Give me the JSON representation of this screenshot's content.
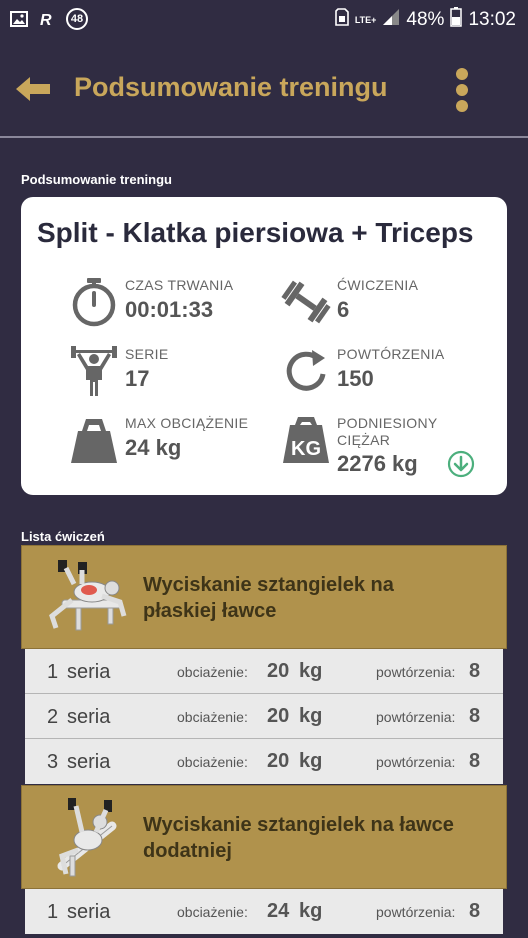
{
  "status": {
    "battery": "48%",
    "time": "13:02",
    "network": "LTE+",
    "notification_badge": "48"
  },
  "appbar": {
    "title": "Podsumowanie treningu",
    "accent": "#c9a75b"
  },
  "summary": {
    "section_label": "Podsumowanie treningu",
    "workout_name": "Split - Klatka piersiowa + Triceps",
    "stats": {
      "duration": {
        "label": "CZAS TRWANIA",
        "value": "00:01:33",
        "icon": "stopwatch-icon"
      },
      "exercises": {
        "label": "ĆWICZENIA",
        "value": "6",
        "icon": "dumbbell-icon"
      },
      "sets": {
        "label": "SERIE",
        "value": "17",
        "icon": "weightlifter-icon"
      },
      "reps": {
        "label": "POWTÓRZENIA",
        "value": "150",
        "icon": "repeat-icon"
      },
      "max_load": {
        "label": "MAX OBCIĄŻENIE",
        "value": "24 kg",
        "icon": "kettlebell-icon"
      },
      "lifted": {
        "label_line1": "PODNIESIONY",
        "label_line2": "CIĘŻAR",
        "value": "2276 kg",
        "icon": "kg-weight-icon"
      }
    }
  },
  "exercise_list": {
    "section_label": "Lista ćwiczeń",
    "set_word": "seria",
    "load_label": "obciażenie:",
    "reps_label": "powtórzenia:",
    "unit": "kg",
    "exercises": [
      {
        "name_line1": "Wyciskanie sztangielek na",
        "name_line2": "płaskiej ławce",
        "sets": [
          {
            "no": "1",
            "load": "20",
            "reps": "8"
          },
          {
            "no": "2",
            "load": "20",
            "reps": "8"
          },
          {
            "no": "3",
            "load": "20",
            "reps": "8"
          }
        ]
      },
      {
        "name_line1": "Wyciskanie sztangielek na ławce",
        "name_line2": "dodatniej",
        "sets": [
          {
            "no": "1",
            "load": "24",
            "reps": "8"
          }
        ]
      }
    ]
  }
}
